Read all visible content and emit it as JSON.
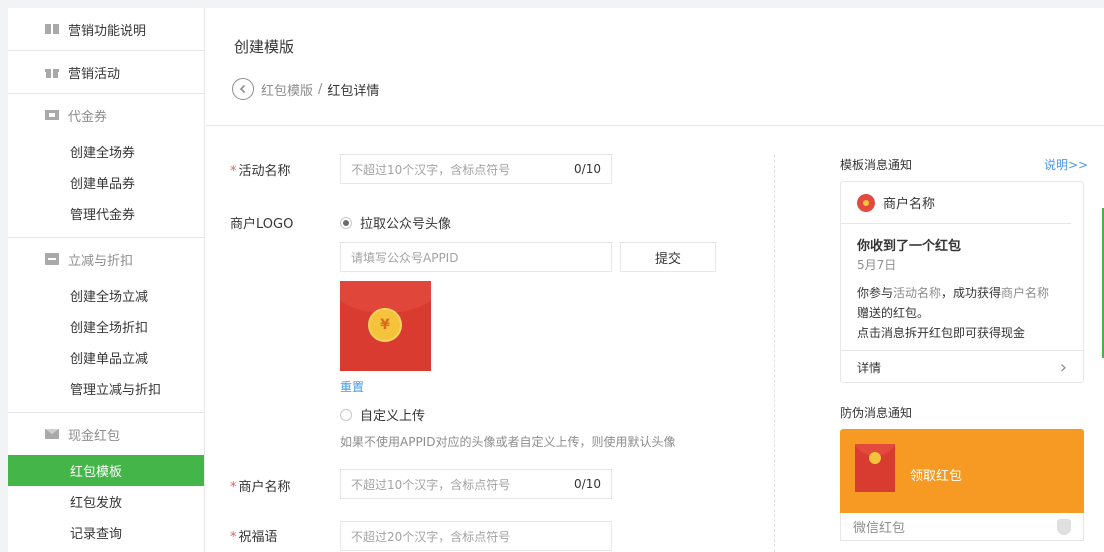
{
  "sidebar": {
    "sections": [
      {
        "label": "营销功能说明",
        "icon": "book-icon",
        "items": []
      },
      {
        "label": "营销活动",
        "icon": "gift-icon",
        "items": []
      },
      {
        "label": "代金券",
        "icon": "voucher-icon",
        "items": [
          "创建全场券",
          "创建单品券",
          "管理代金券"
        ]
      },
      {
        "label": "立减与折扣",
        "icon": "discount-icon",
        "items": [
          "创建全场立减",
          "创建全场折扣",
          "创建单品立减",
          "管理立减与折扣"
        ]
      },
      {
        "label": "现金红包",
        "icon": "envelope-icon",
        "items": [
          "红包模板",
          "红包发放",
          "记录查询"
        ],
        "active": "红包模板"
      }
    ]
  },
  "main": {
    "title": "创建模版",
    "breadcrumb": {
      "link": "红包模版",
      "separator": "/",
      "current": "红包详情"
    }
  },
  "form": {
    "activity_name": {
      "label": "活动名称",
      "placeholder": "不超过10个汉字，含标点符号",
      "count": "0/10"
    },
    "logo": {
      "label": "商户LOGO",
      "option_pull": "拉取公众号头像",
      "appid_placeholder": "请填写公众号APPID",
      "submit": "提交",
      "reset": "重置",
      "option_custom": "自定义上传",
      "hint": "如果不使用APPID对应的头像或者自定义上传，则使用默认头像",
      "coin_symbol": "¥"
    },
    "merchant_name": {
      "label": "商户名称",
      "placeholder": "不超过10个汉字，含标点符号",
      "count": "0/10"
    },
    "blessing": {
      "label": "祝福语",
      "placeholder": "不超过20个汉字，含标点符号"
    }
  },
  "preview": {
    "template_title": "模板消息通知",
    "help_link": "说明>>",
    "card": {
      "merchant": "商户名称",
      "title": "你收到了一个红包",
      "date": "5月7日",
      "line1_prefix": "你参与",
      "line1_activity": "活动名称",
      "line1_mid": "，成功获得",
      "line1_merchant": "商户名称",
      "line2": "赠送的红包。",
      "line3": "点击消息拆开红包即可获得现金",
      "footer": "详情",
      "chevron": "›"
    },
    "anti_fake_title": "防伪消息通知",
    "promo": {
      "label": "领取红包",
      "footer": "微信红包"
    }
  }
}
